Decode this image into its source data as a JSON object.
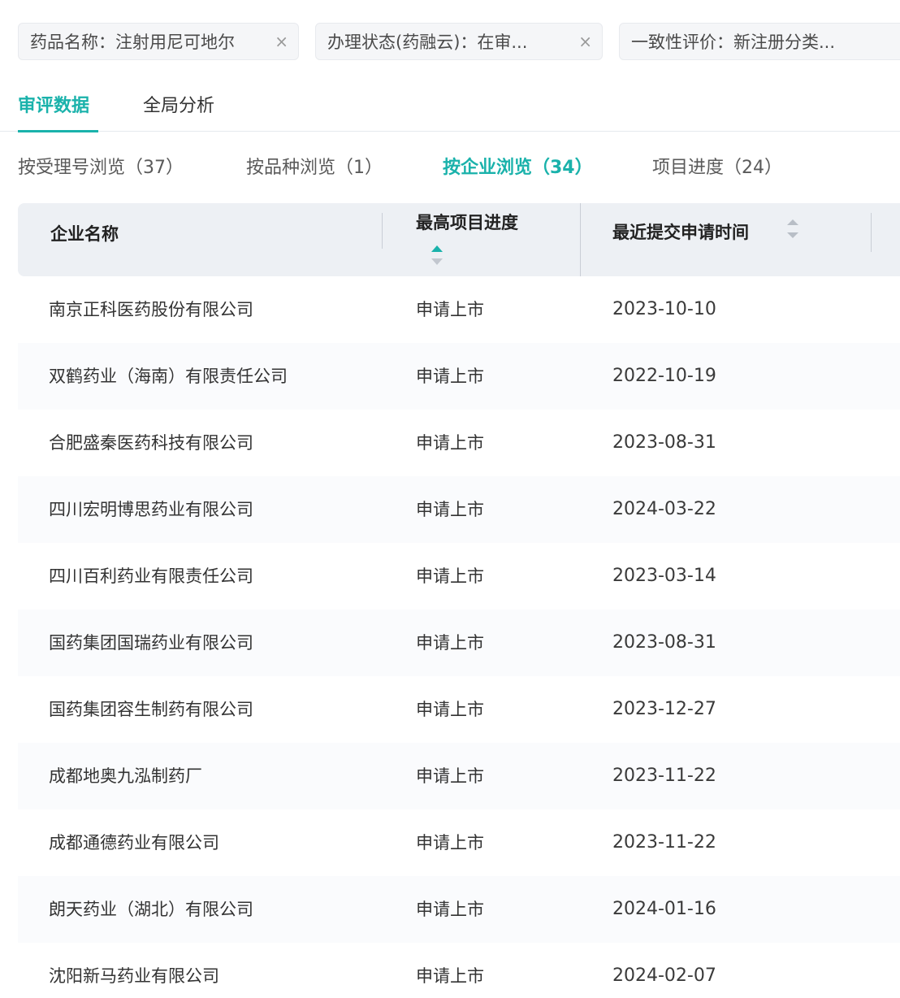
{
  "filters": [
    {
      "text": "药品名称：注射用尼可地尔",
      "close": "×"
    },
    {
      "text": "办理状态(药融云)：在审...",
      "close": "×"
    },
    {
      "text": "一致性评价：新注册分类...",
      "close": "×"
    }
  ],
  "tabs": [
    {
      "label": "审评数据",
      "active": true
    },
    {
      "label": "全局分析",
      "active": false
    }
  ],
  "browse_tabs": [
    {
      "label": "按受理号浏览（37）",
      "active": false
    },
    {
      "label": "按品种浏览（1）",
      "active": false
    },
    {
      "label": "按企业浏览（34）",
      "active": true
    },
    {
      "label": "项目进度（24）",
      "active": false
    }
  ],
  "table": {
    "columns": {
      "company": "企业名称",
      "progress": "最高项目进度",
      "date": "最近提交申请时间"
    },
    "rows": [
      {
        "company": "南京正科医药股份有限公司",
        "progress": "申请上市",
        "date": "2023-10-10"
      },
      {
        "company": "双鹤药业（海南）有限责任公司",
        "progress": "申请上市",
        "date": "2022-10-19"
      },
      {
        "company": "合肥盛秦医药科技有限公司",
        "progress": "申请上市",
        "date": "2023-08-31"
      },
      {
        "company": "四川宏明博思药业有限公司",
        "progress": "申请上市",
        "date": "2024-03-22"
      },
      {
        "company": "四川百利药业有限责任公司",
        "progress": "申请上市",
        "date": "2023-03-14"
      },
      {
        "company": "国药集团国瑞药业有限公司",
        "progress": "申请上市",
        "date": "2023-08-31"
      },
      {
        "company": "国药集团容生制药有限公司",
        "progress": "申请上市",
        "date": "2023-12-27"
      },
      {
        "company": "成都地奥九泓制药厂",
        "progress": "申请上市",
        "date": "2023-11-22"
      },
      {
        "company": "成都通德药业有限公司",
        "progress": "申请上市",
        "date": "2023-11-22"
      },
      {
        "company": "朗天药业（湖北）有限公司",
        "progress": "申请上市",
        "date": "2024-01-16"
      },
      {
        "company": "沈阳新马药业有限公司",
        "progress": "申请上市",
        "date": "2024-02-07"
      }
    ]
  },
  "colors": {
    "accent": "#1ab2ab",
    "header_bg": "#edf0f4",
    "chip_bg": "#f5f6f8"
  },
  "icons": {
    "chip_close": "close-icon",
    "sort": "sort-caret-icon"
  }
}
